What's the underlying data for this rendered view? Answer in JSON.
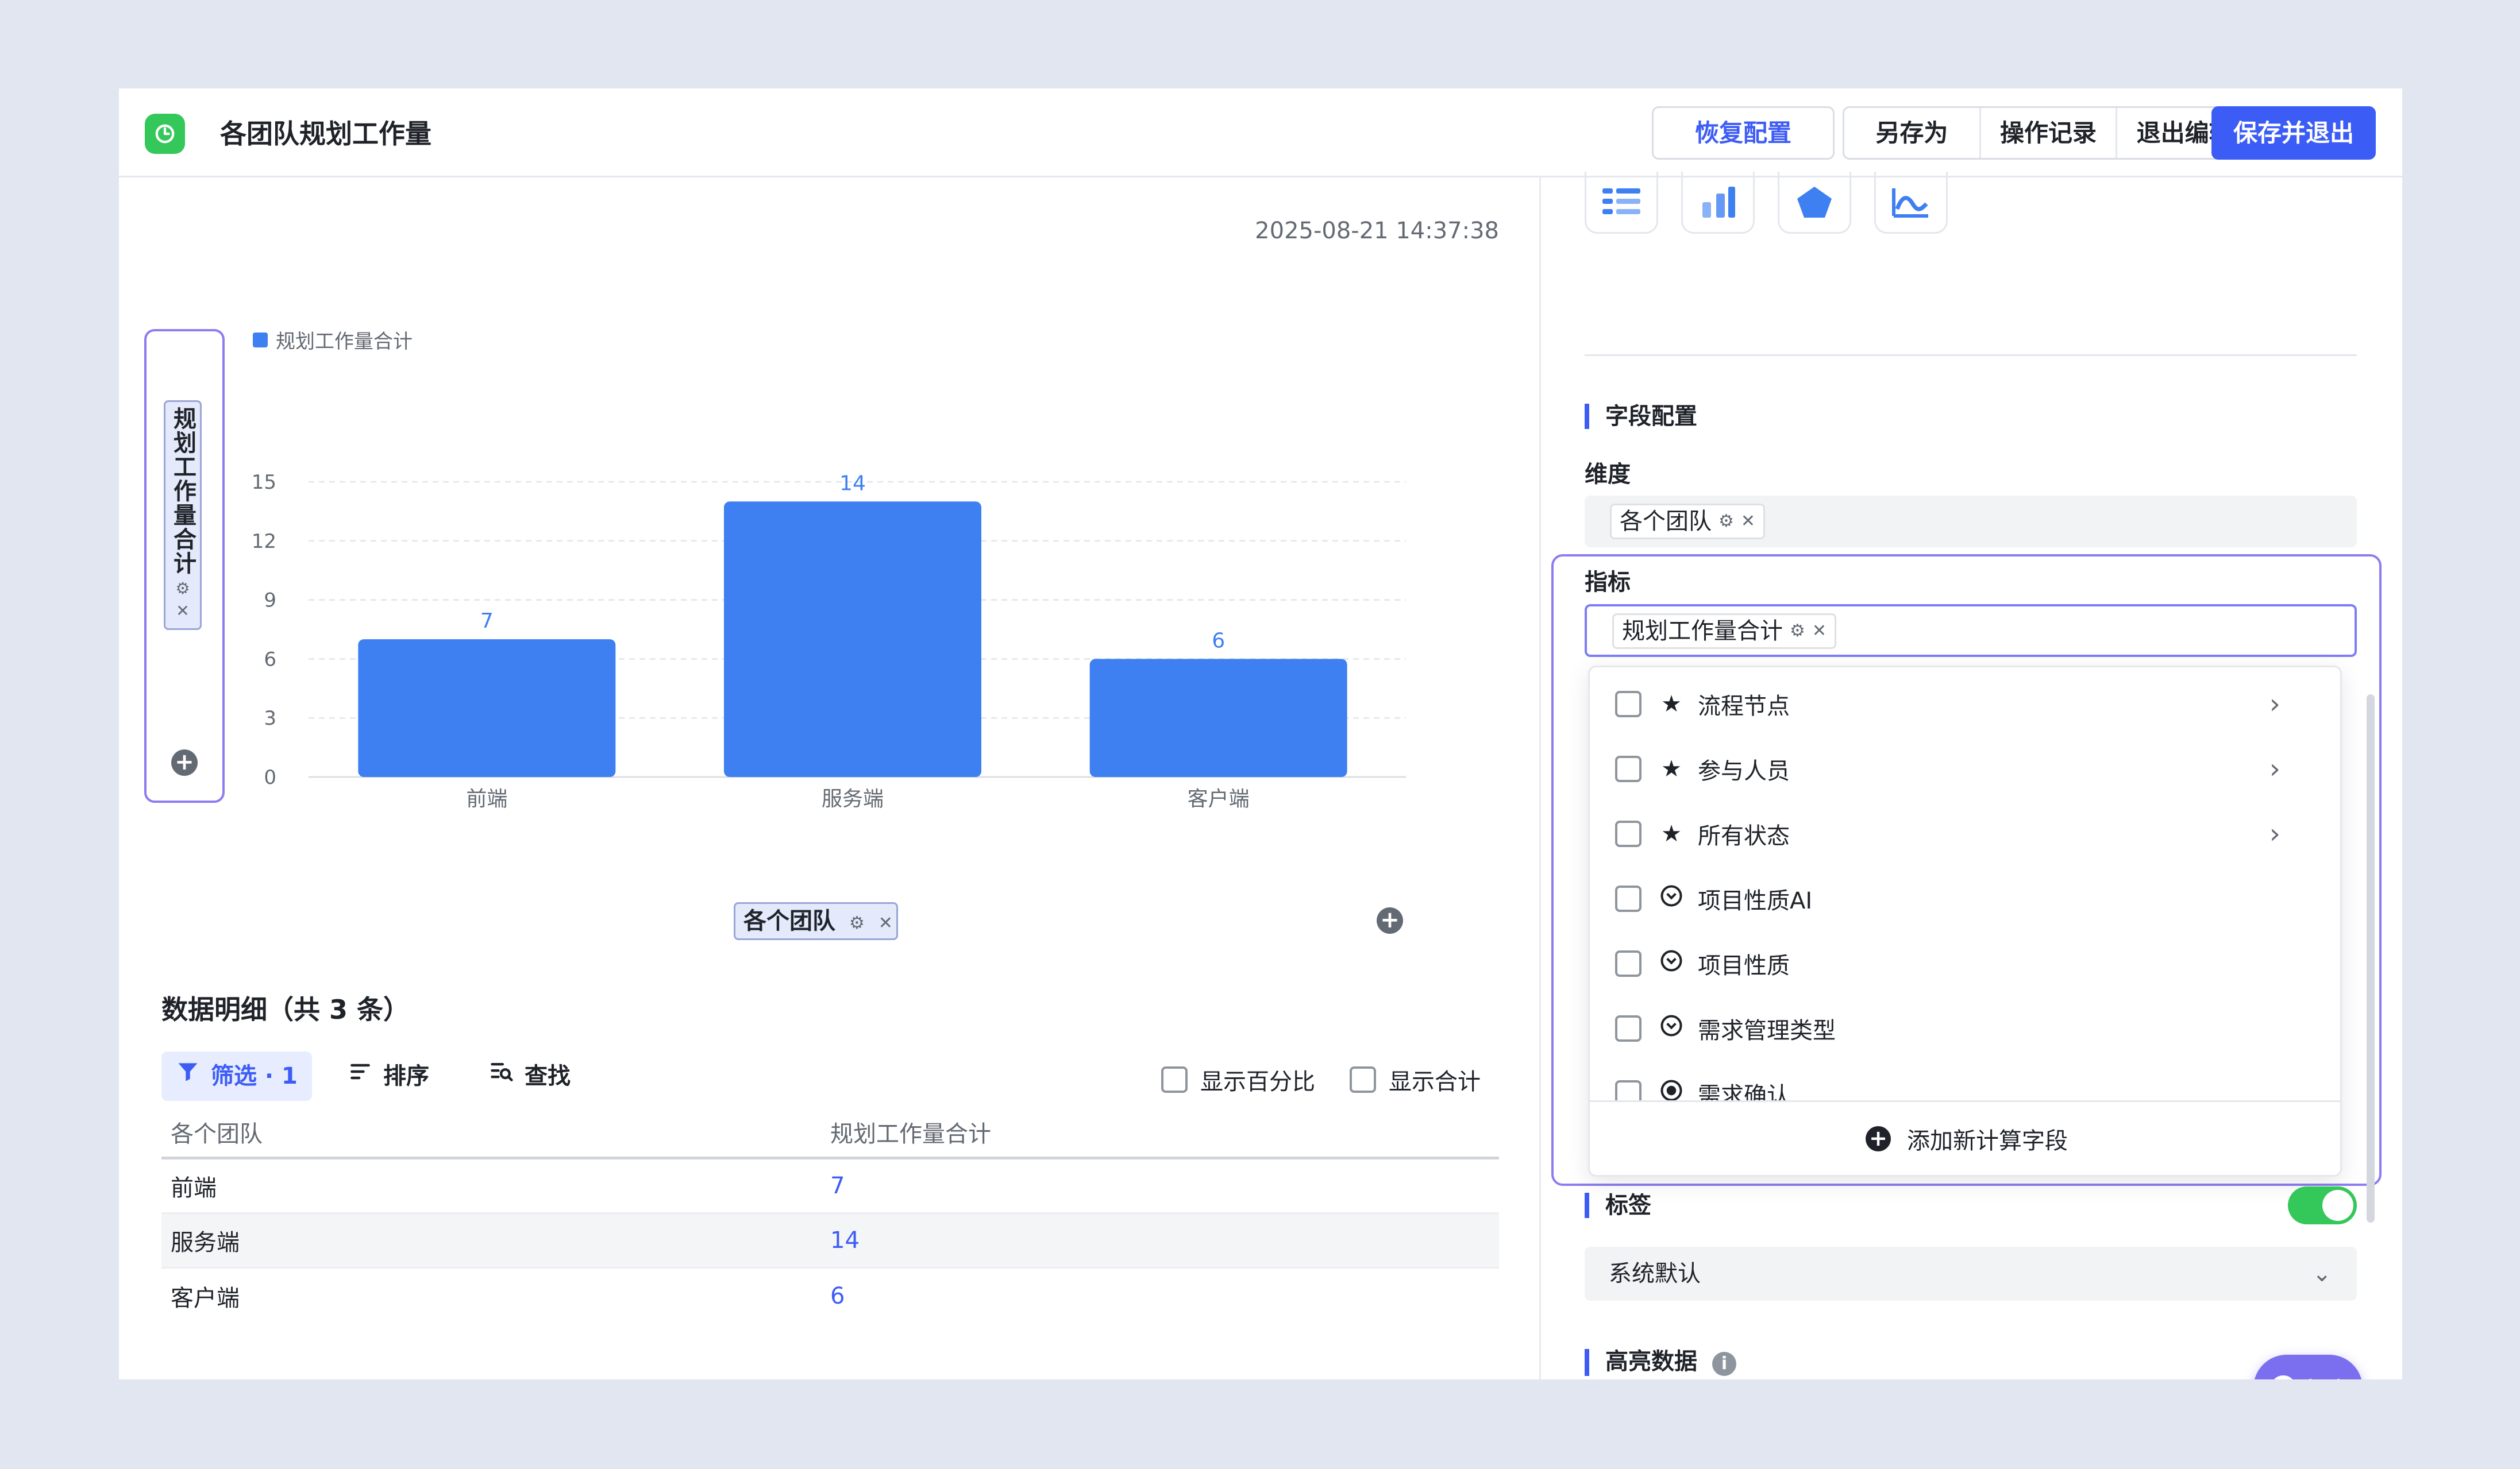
{
  "header": {
    "title": "各团队规划工作量",
    "restore_label": "恢复配置",
    "save_as_label": "另存为",
    "history_label": "操作记录",
    "exit_edit_label": "退出编辑",
    "save_exit_label": "保存并退出"
  },
  "left": {
    "timestamp": "2025-08-21 14:37:38",
    "y_axis_chip": "规划工作量合计",
    "x_axis_chip": "各个团队",
    "detail_title": "数据明细（共 3 条）",
    "toolbar": {
      "filter_label": "筛选 · 1",
      "sort_label": "排序",
      "find_label": "查找",
      "show_percent_label": "显示百分比",
      "show_total_label": "显示合计"
    },
    "table": {
      "columns": [
        "各个团队",
        "规划工作量合计"
      ],
      "rows": [
        {
          "team": "前端",
          "value": "7"
        },
        {
          "team": "服务端",
          "value": "14"
        },
        {
          "team": "客户端",
          "value": "6"
        }
      ]
    }
  },
  "chart_data": {
    "type": "bar",
    "categories": [
      "前端",
      "服务端",
      "客户端"
    ],
    "series": [
      {
        "name": "规划工作量合计",
        "values": [
          7,
          14,
          6
        ]
      }
    ],
    "ylim": [
      0,
      15
    ],
    "yticks": [
      0,
      3,
      6,
      9,
      12,
      15
    ],
    "grid": true,
    "legend": "top-left",
    "color": "#3e7ff2"
  },
  "right": {
    "field_config_title": "字段配置",
    "dimension_label": "维度",
    "dimension_chip": "各个团队",
    "metric_label": "指标",
    "metric_chip": "规划工作量合计",
    "dropdown_items": [
      {
        "label": "流程节点",
        "icon": "star-list-icon",
        "has_arrow": true
      },
      {
        "label": "参与人员",
        "icon": "star-list-icon",
        "has_arrow": true
      },
      {
        "label": "所有状态",
        "icon": "star-list-icon",
        "has_arrow": true
      },
      {
        "label": "项目性质AI",
        "icon": "chevron-circle-icon",
        "has_arrow": false
      },
      {
        "label": "项目性质",
        "icon": "chevron-circle-icon",
        "has_arrow": false
      },
      {
        "label": "需求管理类型",
        "icon": "chevron-circle-icon",
        "has_arrow": false
      },
      {
        "label": "需求确认",
        "icon": "radio-icon",
        "has_arrow": false
      }
    ],
    "add_calc_field_label": "添加新计算字段",
    "label_section_title": "标签",
    "label_select_value": "系统默认",
    "highlight_title": "高亮数据",
    "help_label": "帮助"
  }
}
